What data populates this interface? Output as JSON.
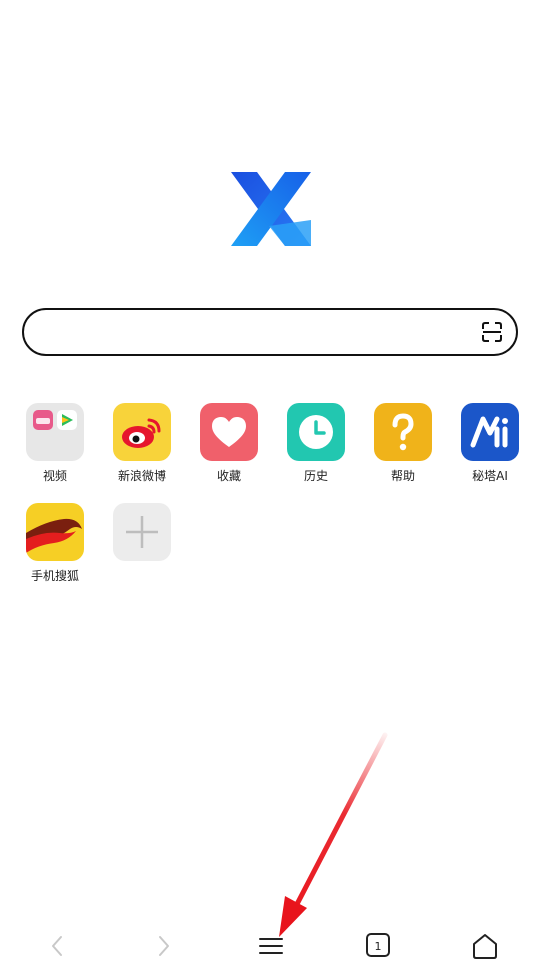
{
  "app": {
    "accent": "#1e7cf2"
  },
  "search": {
    "placeholder": ""
  },
  "shortcuts": [
    {
      "label": "视频",
      "color": "#e8e8e8"
    },
    {
      "label": "新浪微博",
      "color": "#f8d33a"
    },
    {
      "label": "收藏",
      "color": "#f0606b"
    },
    {
      "label": "历史",
      "color": "#22c7b0"
    },
    {
      "label": "帮助",
      "color": "#f0b31a"
    },
    {
      "label": "秘塔AI",
      "color": "#1b56c9"
    },
    {
      "label": "手机搜狐",
      "color": "#f6cf25"
    },
    {
      "label": "",
      "color": "#eeeeee"
    }
  ],
  "icons": {
    "back": "chevron-left-icon",
    "forward": "chevron-right-icon",
    "menu": "menu-icon",
    "tabs": "tabs-icon",
    "home": "home-icon",
    "scan": "scan-icon"
  },
  "tabs": {
    "count": "1"
  },
  "annotation": {
    "color": "#e8141c"
  }
}
